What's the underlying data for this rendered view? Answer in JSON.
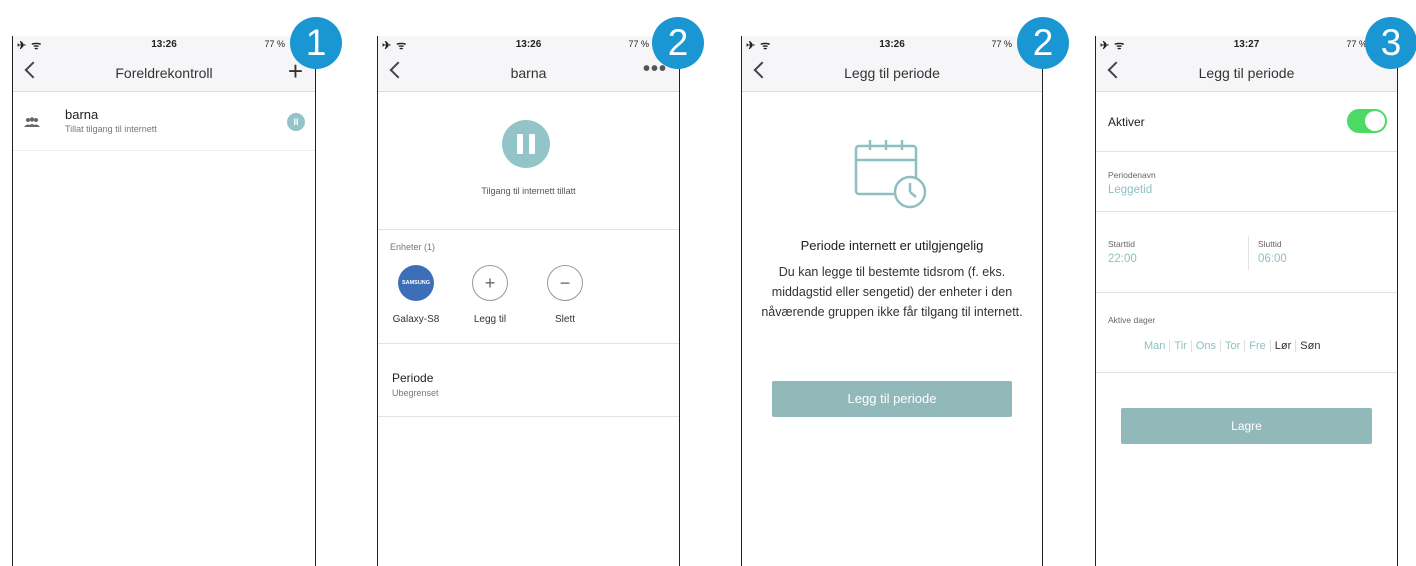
{
  "badges": [
    "1",
    "2",
    "2",
    "3"
  ],
  "status": {
    "signal": "✈ ᯤ",
    "time_1": "13:26",
    "time_2": "13:26",
    "time_3": "13:26",
    "time_4": "13:27",
    "battery": "77 %"
  },
  "screen1": {
    "title": "Foreldrekontroll",
    "group_name": "barna",
    "group_sub": "Tillat tilgang til internett"
  },
  "screen2": {
    "title": "barna",
    "access_text": "Tilgang til internett tillatt",
    "devices_header": "Enheter (1)",
    "samsung_logo": "SAMSUNG",
    "device_label": "Galaxy-S8",
    "add_label": "Legg til",
    "delete_label": "Slett",
    "period_title": "Periode",
    "period_sub": "Ubegrenset"
  },
  "screen3": {
    "title": "Legg til periode",
    "empty_title": "Periode internett er utilgjengelig",
    "empty_desc": "Du kan legge til bestemte tidsrom (f. eks. middagstid eller sengetid) der enheter i den nåværende gruppen ikke får tilgang til internett.",
    "button": "Legg til periode"
  },
  "screen4": {
    "title": "Legg til periode",
    "activate_label": "Aktiver",
    "period_name_label": "Periodenavn",
    "period_name_value": "Leggetid",
    "start_label": "Starttid",
    "start_value": "22:00",
    "end_label": "Sluttid",
    "end_value": "06:00",
    "days_label": "Aktive dager",
    "days": [
      "Man",
      "Tir",
      "Ons",
      "Tor",
      "Fre",
      "Lør",
      "Søn"
    ],
    "save_button": "Lagre"
  },
  "colors": {
    "accent_teal": "#92c4c8",
    "badge_blue": "#1a97d3",
    "toggle_green": "#4cd964",
    "button_teal": "#92b9ba"
  }
}
